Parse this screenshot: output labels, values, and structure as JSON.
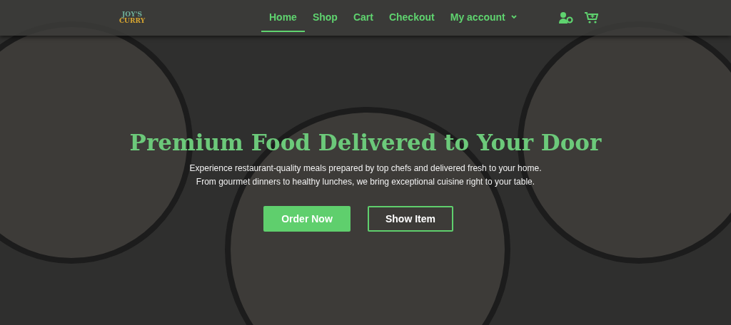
{
  "logo": {
    "line_1": "JOY'S",
    "line_2": "CURRY"
  },
  "nav": [
    {
      "label": "Home",
      "selected": true,
      "dropdown": false
    },
    {
      "label": "Shop",
      "selected": false,
      "dropdown": false
    },
    {
      "label": "Cart",
      "selected": false,
      "dropdown": false
    },
    {
      "label": "Checkout",
      "selected": false,
      "dropdown": false
    },
    {
      "label": "My account",
      "selected": false,
      "dropdown": true
    }
  ],
  "hero": {
    "title": "Premium Food Delivered to Your Door",
    "lines": [
      "Experience restaurant-quality meals prepared by top chefs and delivered fresh to your home.",
      "From gourmet dinners to healthy lunches, we bring exceptional cuisine right to your table."
    ],
    "buttons": [
      {
        "label": "Order Now",
        "kind": "filled"
      },
      {
        "label": "Show Item",
        "kind": "outline"
      }
    ]
  }
}
